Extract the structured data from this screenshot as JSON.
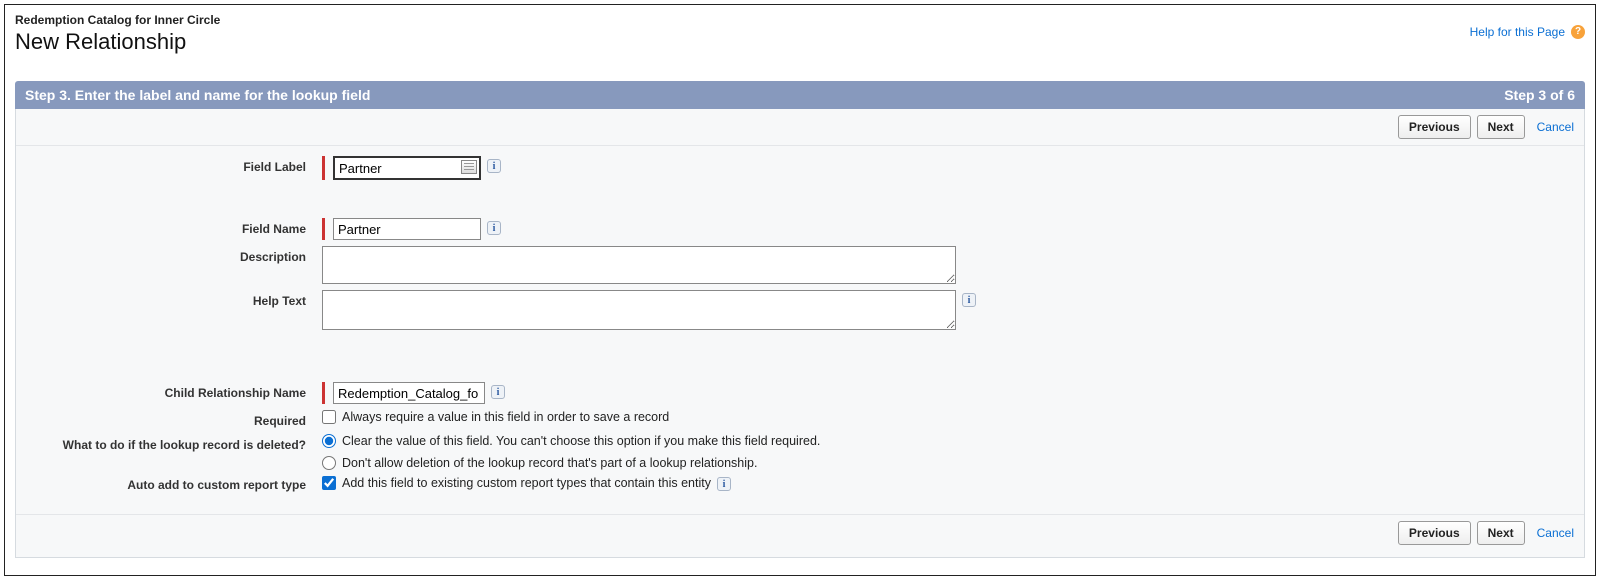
{
  "header": {
    "subtitle": "Redemption Catalog for Inner Circle",
    "title": "New Relationship",
    "help_link": "Help for this Page"
  },
  "step": {
    "title": "Step 3. Enter the label and name for the lookup field",
    "progress": "Step 3 of 6"
  },
  "buttons": {
    "previous": "Previous",
    "next": "Next",
    "cancel": "Cancel"
  },
  "labels": {
    "field_label": "Field Label",
    "field_name": "Field Name",
    "description": "Description",
    "help_text": "Help Text",
    "child_rel_name": "Child Relationship Name",
    "required": "Required",
    "delete_action": "What to do if the lookup record is deleted?",
    "auto_add": "Auto add to custom report type"
  },
  "fields": {
    "field_label_value": "Partner",
    "field_name_value": "Partner",
    "description_value": "",
    "help_text_value": "",
    "child_rel_value": "Redemption_Catalog_fo"
  },
  "options": {
    "required_text": "Always require a value in this field in order to save a record",
    "required_checked": false,
    "delete_clear": "Clear the value of this field. You can't choose this option if you make this field required.",
    "delete_no": "Don't allow deletion of the lookup record that's part of a lookup relationship.",
    "delete_selected": "clear",
    "auto_add_text": "Add this field to existing custom report types that contain this entity",
    "auto_add_checked": true
  }
}
